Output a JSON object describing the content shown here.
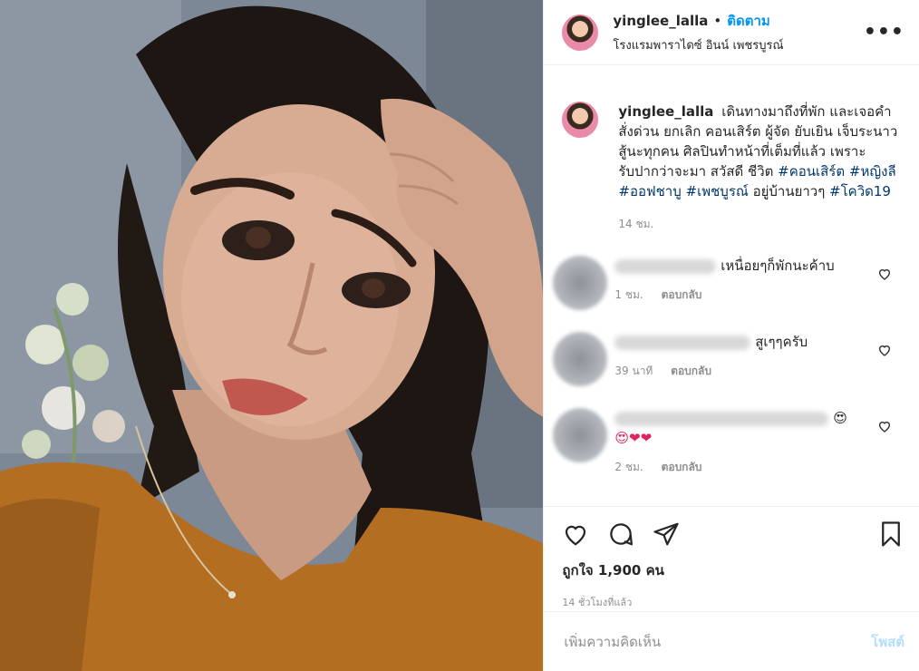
{
  "header": {
    "username": "yinglee_lalla",
    "separator": "•",
    "follow_label": "ติดตาม",
    "location": "โรงแรมพาราไดซ์ อินน์ เพชรบูรณ์",
    "more_label": "•••"
  },
  "caption": {
    "username": "yinglee_lalla",
    "text": "เดินทางมาถึงที่พัก และเจอคำสั่งด่วน ยกเลิก คอนเสิร์ต ผู้จัด ยับเยิน เจ็บระนาว สู้นะทุกคน ศิลปินทำหน้าที่เต็มที่แล้ว เพราะรับปากว่าจะมา สวัสดี ชีวิต",
    "hashtags": [
      "#คอนเสิร์ต",
      "#หญิงลี",
      "#ออฟชาบู",
      "#เพชบูรณ์"
    ],
    "text2": "อยู่บ้านยาวๆ",
    "hashtag_last": "#โควิด19",
    "time": "14 ชม."
  },
  "comments": [
    {
      "text": "เหนื่อยๆก็พักนะค้าบ",
      "time": "1 ชม.",
      "reply": "ตอบกลับ"
    },
    {
      "text": "สูเๆๆครับ",
      "time": "39 นาที",
      "reply": "ตอบกลับ"
    },
    {
      "text": "😍",
      "text2": "😍❤❤",
      "time": "2 ชม.",
      "reply": "ตอบกลับ"
    }
  ],
  "actions": {
    "likes": "ถูกใจ 1,900 คน",
    "ago": "14 ชั่วโมงที่แล้ว"
  },
  "add_comment": {
    "placeholder": "เพิ่มความคิดเห็น",
    "post_label": "โพสต์"
  },
  "colors": {
    "link": "#0095f6",
    "hashtag": "#00376b",
    "muted": "#8e8e8e",
    "post_disabled": "#b2dffc"
  },
  "icons": [
    "heart-icon",
    "comment-icon",
    "share-icon",
    "bookmark-icon",
    "more-icon"
  ]
}
